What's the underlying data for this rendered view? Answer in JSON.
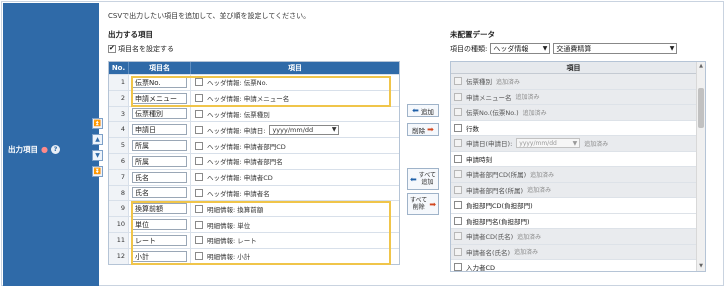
{
  "section": {
    "label": "出力項目",
    "required_mark": "●",
    "help_glyph": "?"
  },
  "instruction": "CSVで出力したい項目を追加して、並び順を設定してください。",
  "left": {
    "heading": "出力する項目",
    "set_names_label": "項目名を設定する",
    "set_names_checked": true,
    "columns": {
      "no": "No.",
      "name": "項目名",
      "item": "項目"
    },
    "rows": [
      {
        "no": "1",
        "name": "伝票No.",
        "item": "ヘッダ情報: 伝票No."
      },
      {
        "no": "2",
        "name": "申請メニュー",
        "item": "ヘッダ情報: 申請メニュー名"
      },
      {
        "no": "3",
        "name": "伝票種別",
        "item": "ヘッダ情報: 伝票種別"
      },
      {
        "no": "4",
        "name": "申請日",
        "item": "ヘッダ情報: 申請日:",
        "date_placeholder": "yyyy/mm/dd"
      },
      {
        "no": "5",
        "name": "所属",
        "item": "ヘッダ情報: 申請者部門CD"
      },
      {
        "no": "6",
        "name": "所属",
        "item": "ヘッダ情報: 申請者部門名"
      },
      {
        "no": "7",
        "name": "氏名",
        "item": "ヘッダ情報: 申請者CD"
      },
      {
        "no": "8",
        "name": "氏名",
        "item": "ヘッダ情報: 申請者名"
      },
      {
        "no": "9",
        "name": "換算前額",
        "item": "明細情報: 換算前額"
      },
      {
        "no": "10",
        "name": "単位",
        "item": "明細情報: 単位"
      },
      {
        "no": "11",
        "name": "レート",
        "item": "明細情報: レート"
      },
      {
        "no": "12",
        "name": "小計",
        "item": "明細情報: 小計"
      }
    ]
  },
  "order_buttons": {
    "top_icon": "double-up-arrow-icon",
    "top_glyph": "⏫",
    "up_icon": "up-arrow-icon",
    "up_glyph": "▲",
    "down_icon": "down-arrow-icon",
    "down_glyph": "▼",
    "bottom_icon": "double-down-arrow-icon",
    "bottom_glyph": "⏬"
  },
  "middle": {
    "add_label": "追加",
    "remove_label": "削除",
    "add_all_line1": "すべて",
    "add_all_line2": "追加",
    "remove_all_line1": "すべて",
    "remove_all_line2": "削除",
    "left_arrow": "⬅",
    "right_arrow": "➡"
  },
  "right": {
    "heading": "未配置データ",
    "type_label": "項目の種類:",
    "type_select_1": "ヘッダ情報",
    "type_select_2": "交通費精算",
    "column": "項目",
    "added_tag": "追加済み",
    "date_placeholder": "yyyy/mm/dd",
    "rows": [
      {
        "label": "伝票種別",
        "added": true
      },
      {
        "label": "申請メニュー名",
        "added": true
      },
      {
        "label": "伝票No.(伝票No.)",
        "added": true
      },
      {
        "label": "行数",
        "added": false
      },
      {
        "label": "申請日(申請日):",
        "added": true,
        "date": true
      },
      {
        "label": "申請時刻",
        "added": false
      },
      {
        "label": "申請者部門CD(所属)",
        "added": true
      },
      {
        "label": "申請者部門名(所属)",
        "added": true
      },
      {
        "label": "負担部門CD(負担部門)",
        "added": false
      },
      {
        "label": "負担部門名(負担部門)",
        "added": false
      },
      {
        "label": "申請者CD(氏名)",
        "added": true
      },
      {
        "label": "申請者名(氏名)",
        "added": true
      },
      {
        "label": "入力者CD",
        "added": false
      }
    ]
  },
  "colors": {
    "primary": "#2f6aa8",
    "highlight": "#f0c54a",
    "remove_arrow": "#d2461e"
  }
}
